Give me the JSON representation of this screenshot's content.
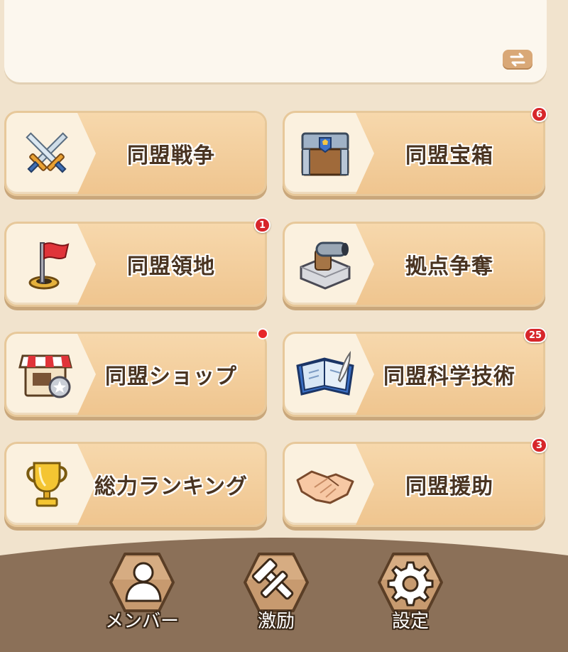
{
  "menu": {
    "items": [
      {
        "id": "war",
        "label": "同盟戦争",
        "icon": "crossed-swords-icon",
        "badge": ""
      },
      {
        "id": "chest",
        "label": "同盟宝箱",
        "icon": "treasure-chest-icon",
        "badge": "6"
      },
      {
        "id": "territory",
        "label": "同盟領地",
        "icon": "red-flag-icon",
        "badge": "1"
      },
      {
        "id": "stronghold",
        "label": "拠点争奪",
        "icon": "cannon-fort-icon",
        "badge": ""
      },
      {
        "id": "shop",
        "label": "同盟ショップ",
        "icon": "shop-icon",
        "badge": ""
      },
      {
        "id": "tech",
        "label": "同盟科学技術",
        "icon": "blueprint-book-icon",
        "badge": "25"
      },
      {
        "id": "ranking",
        "label": "総力ランキング",
        "icon": "trophy-icon",
        "badge": ""
      },
      {
        "id": "assist",
        "label": "同盟援助",
        "icon": "handshake-icon",
        "badge": "3"
      }
    ]
  },
  "bottom_nav": {
    "members_label": "メンバー",
    "encourage_label": "激励",
    "settings_label": "設定"
  },
  "colors": {
    "badge": "#d7262b",
    "accent": "#efc58f",
    "bottom_bar": "#8b7058"
  }
}
